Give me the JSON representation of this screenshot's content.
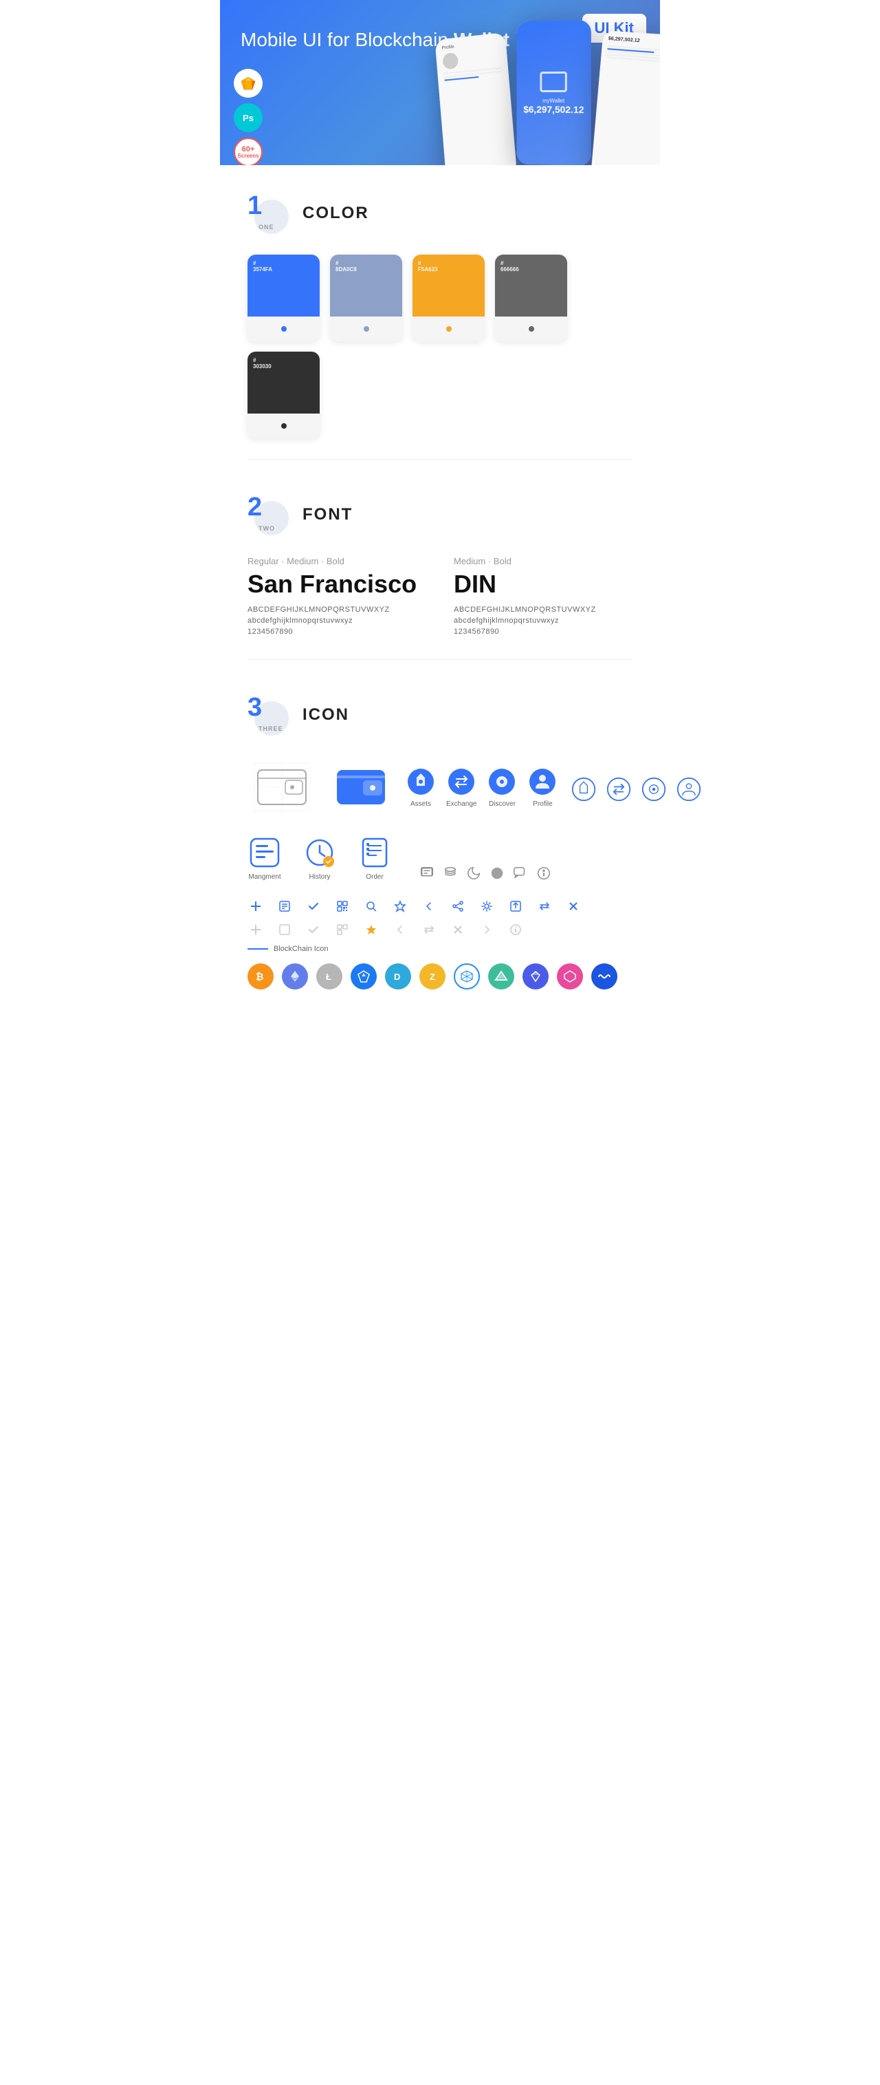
{
  "hero": {
    "title": "Mobile UI for Blockchain ",
    "title_bold": "Wallet",
    "badge": "UI Kit",
    "badge_sketch": "🎨",
    "badge_ps": "Ps",
    "badge_screens_line1": "60+",
    "badge_screens_line2": "Screens"
  },
  "sections": {
    "color": {
      "num": "1",
      "sub": "ONE",
      "title": "COLOR",
      "swatches": [
        {
          "hex": "#3574FA",
          "label": "#3574FA",
          "color": "#3574FA"
        },
        {
          "hex": "#8DA0C8",
          "label": "#8DA0C8",
          "color": "#8DA0C8"
        },
        {
          "hex": "#F5A623",
          "label": "#F5A623",
          "color": "#F5A623"
        },
        {
          "hex": "#666666",
          "label": "#666666",
          "color": "#666666"
        },
        {
          "hex": "#303030",
          "label": "#303030",
          "color": "#303030"
        }
      ]
    },
    "font": {
      "num": "2",
      "sub": "TWO",
      "title": "FONT",
      "fonts": [
        {
          "style": "Regular · Medium · Bold",
          "name": "San Francisco",
          "uppercase": "ABCDEFGHIJKLMNOPQRSTUVWXYZ",
          "lowercase": "abcdefghijklmnopqrstuvwxyz",
          "numbers": "1234567890"
        },
        {
          "style": "Medium · Bold",
          "name": "DIN",
          "uppercase": "ABCDEFGHIJKLMNOPQRSTUVWXYZ",
          "lowercase": "abcdefghijklmnopqrstuvwxyz",
          "numbers": "1234567890"
        }
      ]
    },
    "icon": {
      "num": "3",
      "sub": "THREE",
      "title": "ICON",
      "nav_icons": [
        {
          "label": "Assets"
        },
        {
          "label": "Exchange"
        },
        {
          "label": "Discover"
        },
        {
          "label": "Profile"
        }
      ],
      "main_icons": [
        {
          "label": "Mangment"
        },
        {
          "label": "History"
        },
        {
          "label": "Order"
        }
      ],
      "blockchain_label": "BlockChain Icon",
      "crypto": [
        {
          "symbol": "₿",
          "color": "#F7931A",
          "bg": "#F7931A"
        },
        {
          "symbol": "Ξ",
          "color": "#627EEA",
          "bg": "#627EEA"
        },
        {
          "symbol": "Ł",
          "color": "#B6B6B6",
          "bg": "#B6B6B6"
        },
        {
          "symbol": "◈",
          "color": "#1B7AF3",
          "bg": "#1B7AF3"
        },
        {
          "symbol": "Ð",
          "color": "#2FA8DC",
          "bg": "#2FA8DC"
        },
        {
          "symbol": "Z",
          "color": "#F4B728",
          "bg": "#F4B728"
        },
        {
          "symbol": "⬡",
          "color": "#1A8FFF",
          "bg": "#1A8FFF"
        },
        {
          "symbol": "△",
          "color": "#3EBD9A",
          "bg": "#3EBD9A"
        },
        {
          "symbol": "◆",
          "color": "#4A5BE8",
          "bg": "#4A5BE8"
        },
        {
          "symbol": "◇",
          "color": "#E94A9C",
          "bg": "#E94A9C"
        },
        {
          "symbol": "~",
          "color": "#1B55E2",
          "bg": "#1B55E2"
        }
      ]
    }
  }
}
